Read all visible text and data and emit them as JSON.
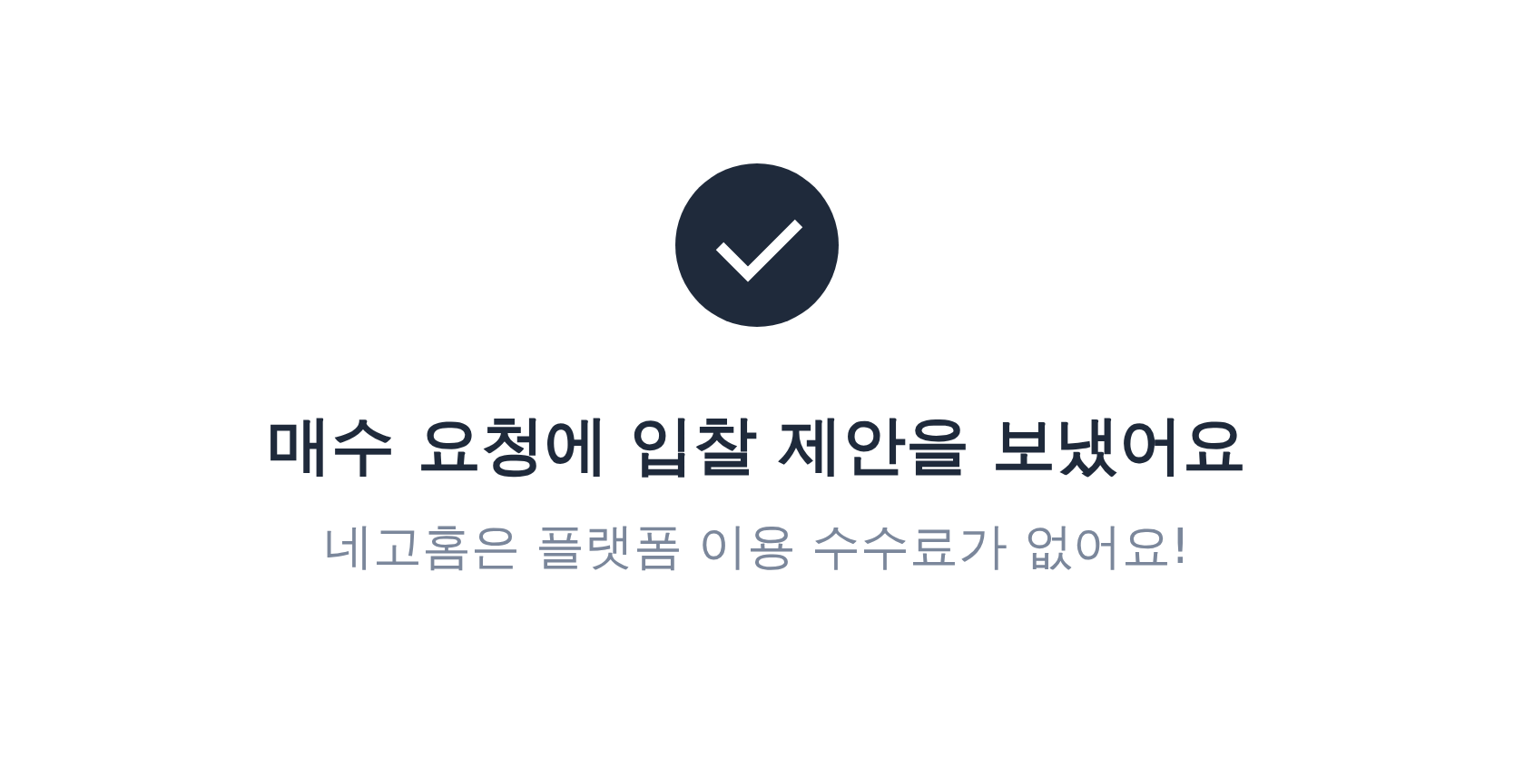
{
  "title": "매수 요청에 입찰 제안을 보냈어요",
  "subtitle": "네고홈은 플랫폼 이용 수수료가 없어요!"
}
